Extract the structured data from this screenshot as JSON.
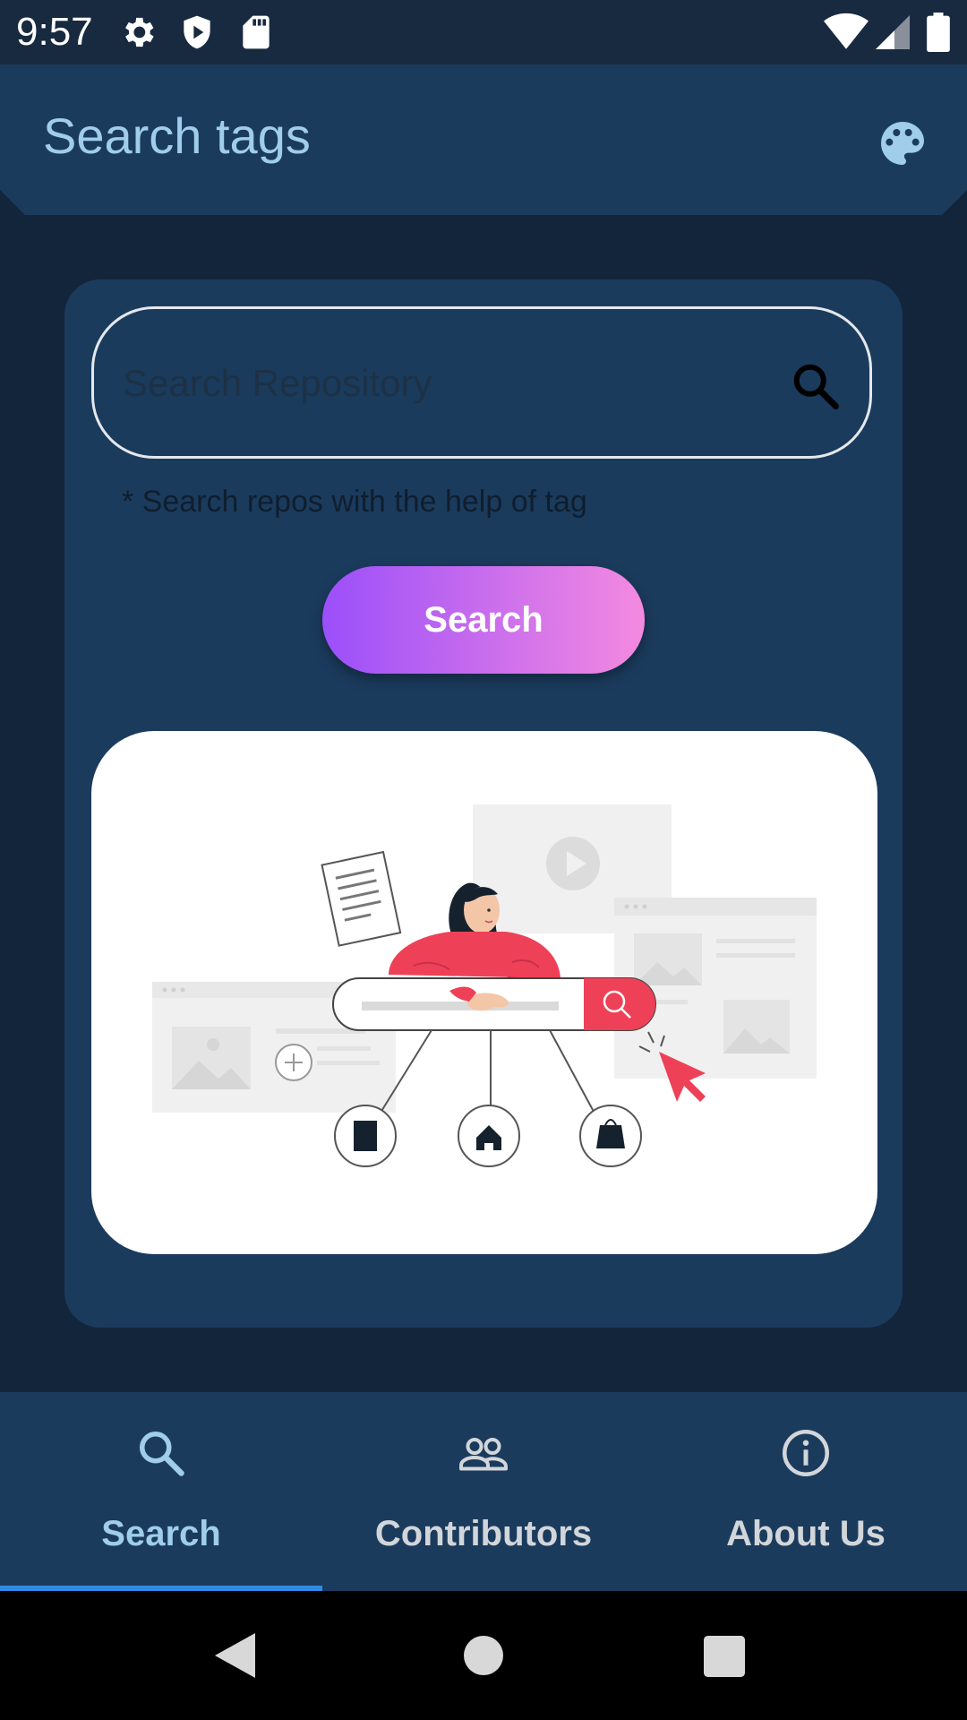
{
  "status_bar": {
    "time": "9:57",
    "icons": [
      "gear-icon",
      "shield-play-icon",
      "sd-card-icon",
      "wifi-icon",
      "signal-icon",
      "battery-icon"
    ]
  },
  "app_bar": {
    "title": "Search tags",
    "action_icon": "palette-icon"
  },
  "search": {
    "placeholder": "Search Repository",
    "value": "",
    "hint": "* Search repos with the help of tag",
    "button_label": "Search"
  },
  "illustration": {
    "subject": "woman-with-search-bar-illustration",
    "accent": "#f0414f"
  },
  "bottom_nav": {
    "items": [
      {
        "label": "Search",
        "icon": "search-icon",
        "active": true
      },
      {
        "label": "Contributors",
        "icon": "people-icon",
        "active": false
      },
      {
        "label": "About Us",
        "icon": "info-icon",
        "active": false
      }
    ]
  },
  "system_nav": {
    "icons": [
      "back-icon",
      "home-icon",
      "recents-icon"
    ]
  },
  "colors": {
    "background": "#13253b",
    "surface": "#1b3b5d",
    "title": "#9fcdea",
    "active_tab": "#9fcdea",
    "inactive_tab": "#d2d6da",
    "indicator": "#2f8be3",
    "button_gradient_start": "#9b4ffa",
    "button_gradient_end": "#f48ae0"
  }
}
